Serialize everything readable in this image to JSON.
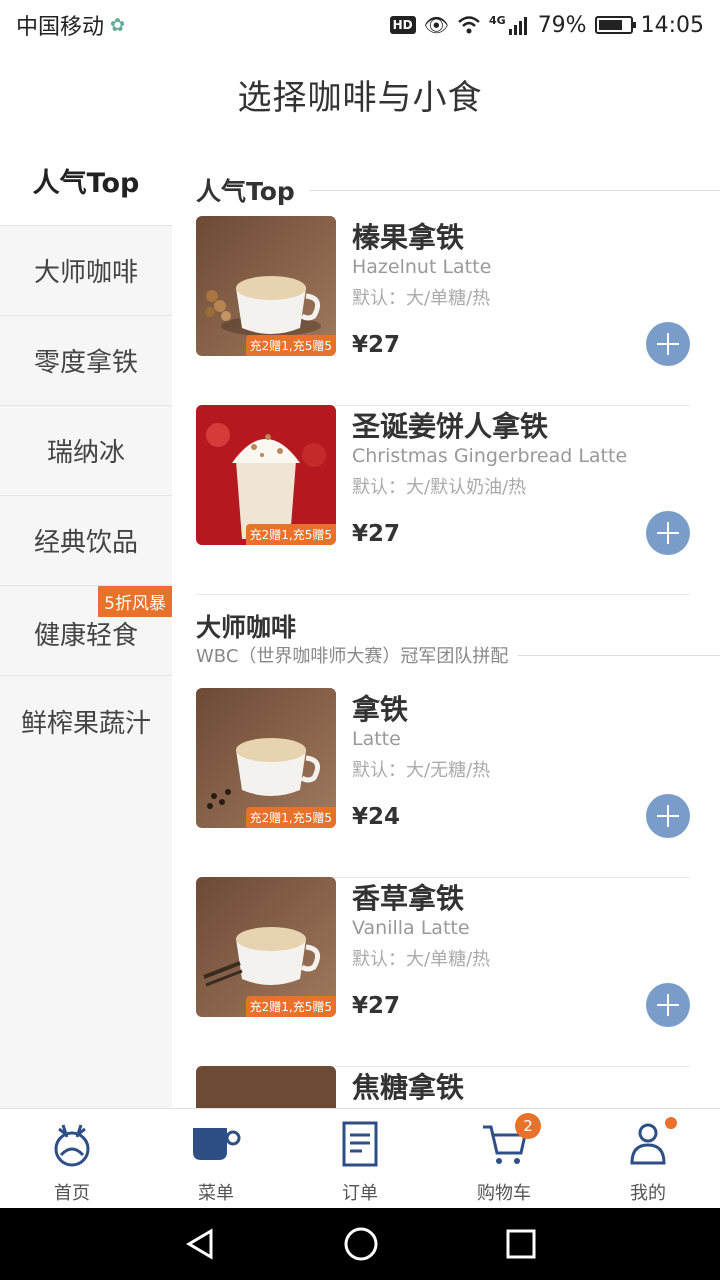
{
  "status": {
    "carrier": "中国移动",
    "hd": "HD",
    "network": "4G",
    "battery": "79%",
    "time": "14:05"
  },
  "title": "选择咖啡与小食",
  "sidebar": {
    "items": [
      {
        "label": "人气Top"
      },
      {
        "label": "大师咖啡"
      },
      {
        "label": "零度拿铁"
      },
      {
        "label": "瑞纳冰"
      },
      {
        "label": "经典饮品"
      },
      {
        "label": "健康轻食",
        "badge": "5折风暴"
      },
      {
        "label": "鲜榨果蔬汁"
      }
    ]
  },
  "sections": [
    {
      "title": "人气Top"
    },
    {
      "title": "大师咖啡",
      "subtitle": "WBC（世界咖啡师大赛）冠军团队拼配"
    }
  ],
  "products": [
    {
      "name": "榛果拿铁",
      "en": "Hazelnut Latte",
      "default": "默认：大/单糖/热",
      "price": "¥27",
      "promo": "充2赠1,充5赠5"
    },
    {
      "name": "圣诞姜饼人拿铁",
      "en": "Christmas Gingerbread Latte",
      "default": "默认：大/默认奶油/热",
      "price": "¥27",
      "promo": "充2赠1,充5赠5"
    },
    {
      "name": "拿铁",
      "en": "Latte",
      "default": "默认：大/无糖/热",
      "price": "¥24",
      "promo": "充2赠1,充5赠5"
    },
    {
      "name": "香草拿铁",
      "en": "Vanilla Latte",
      "default": "默认：大/单糖/热",
      "price": "¥27",
      "promo": "充2赠1,充5赠5"
    },
    {
      "name": "焦糖拿铁"
    }
  ],
  "tabbar": {
    "tabs": [
      {
        "label": "首页",
        "icon": "deer-logo-icon"
      },
      {
        "label": "菜单",
        "icon": "coffee-cup-icon"
      },
      {
        "label": "订单",
        "icon": "order-list-icon"
      },
      {
        "label": "购物车",
        "icon": "cart-icon",
        "badge": "2"
      },
      {
        "label": "我的",
        "icon": "user-icon"
      }
    ]
  },
  "colors": {
    "accent": "#e8722b",
    "brand_blue": "#7a9cc8",
    "brand_dark": "#2e4f86"
  }
}
